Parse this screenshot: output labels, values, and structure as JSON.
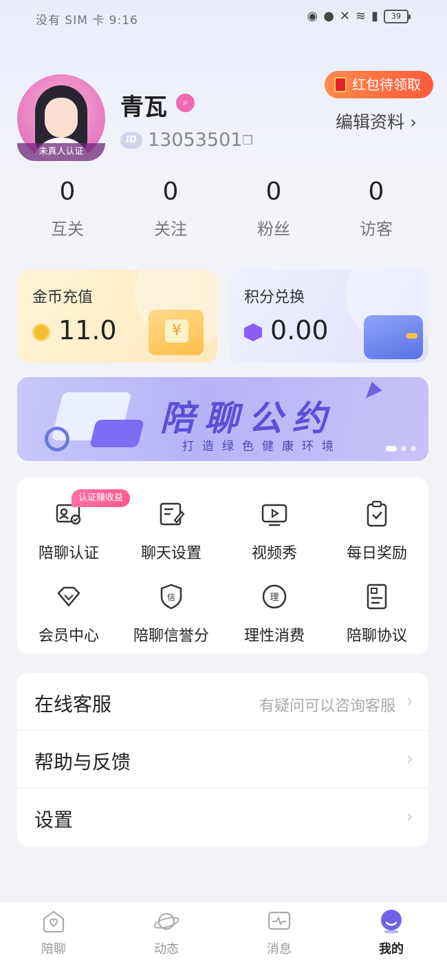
{
  "status_bar": {
    "carrier": "没有 SIM 卡 9:16",
    "icons": [
      "eye-icon",
      "nfc-icon",
      "mute-icon",
      "wifi-icon",
      "battery-saver-icon"
    ],
    "battery": "39"
  },
  "profile": {
    "avatar_badge": "未真人认证",
    "name": "青瓦",
    "id_tag": "ID",
    "user_id": "13053501",
    "redpacket_label": "红包待领取",
    "edit_label": "编辑资料 ›"
  },
  "stats": [
    {
      "value": "0",
      "label": "互关"
    },
    {
      "value": "0",
      "label": "关注"
    },
    {
      "value": "0",
      "label": "粉丝"
    },
    {
      "value": "0",
      "label": "访客"
    }
  ],
  "wallet": {
    "coins_title": "金币充值",
    "coins_amount": "11.0",
    "points_title": "积分兑换",
    "points_amount": "0.00"
  },
  "banner": {
    "headline": "陪聊公约",
    "sub": "打造绿色健康环境",
    "active_dot": 1,
    "dot_count": 3
  },
  "grid": {
    "badge": "认证赚收益",
    "items": [
      {
        "label": "陪聊认证",
        "icon": "id-card-icon"
      },
      {
        "label": "聊天设置",
        "icon": "edit-note-icon"
      },
      {
        "label": "视频秀",
        "icon": "video-play-icon"
      },
      {
        "label": "每日奖励",
        "icon": "clipboard-check-icon"
      },
      {
        "label": "会员中心",
        "icon": "diamond-icon"
      },
      {
        "label": "陪聊信誉分",
        "icon": "shield-credit-icon"
      },
      {
        "label": "理性消费",
        "icon": "rational-icon"
      },
      {
        "label": "陪聊协议",
        "icon": "document-icon"
      }
    ]
  },
  "list": [
    {
      "title": "在线客服",
      "hint": "有疑问可以咨询客服"
    },
    {
      "title": "帮助与反馈",
      "hint": ""
    },
    {
      "title": "设置",
      "hint": ""
    }
  ],
  "tabbar": [
    {
      "label": "陪聊",
      "icon": "heart-home-icon",
      "active": false
    },
    {
      "label": "动态",
      "icon": "planet-icon",
      "active": false
    },
    {
      "label": "消息",
      "icon": "message-icon",
      "active": false
    },
    {
      "label": "我的",
      "icon": "profile-icon",
      "active": true
    }
  ],
  "colors": {
    "accent": "#5b4fd9",
    "pink": "#f06ab5",
    "redpacket": "#ff5a3c"
  }
}
